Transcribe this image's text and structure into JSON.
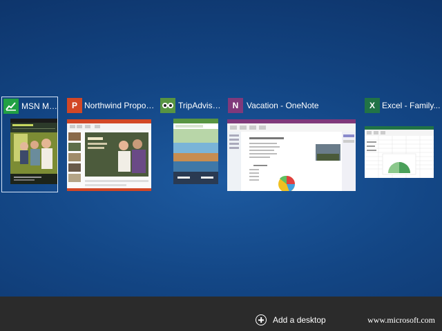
{
  "colors": {
    "background": "#134685",
    "taskbar": "#2b2b2b",
    "msn_icon": "#21a044",
    "powerpoint_icon": "#d24726",
    "tripadvisor_icon": "#589442",
    "onenote_icon": "#80397b",
    "excel_icon": "#217346"
  },
  "windows": [
    {
      "title": "MSN Mon...",
      "icon": "msn-money-icon",
      "selected": true
    },
    {
      "title": "Northwind Proposa...",
      "icon": "powerpoint-icon",
      "icon_letter": "P"
    },
    {
      "title": "TripAdvisor...",
      "icon": "tripadvisor-owl-icon"
    },
    {
      "title": "Vacation - OneNote",
      "icon": "onenote-icon",
      "icon_letter": "N"
    },
    {
      "title": "Excel - Family...",
      "icon": "excel-icon",
      "icon_letter": "X"
    }
  ],
  "taskbar": {
    "add_desktop_label": "Add a desktop",
    "add_desktop_icon": "plus-circle-icon"
  },
  "watermark": "www.microsoft.com"
}
